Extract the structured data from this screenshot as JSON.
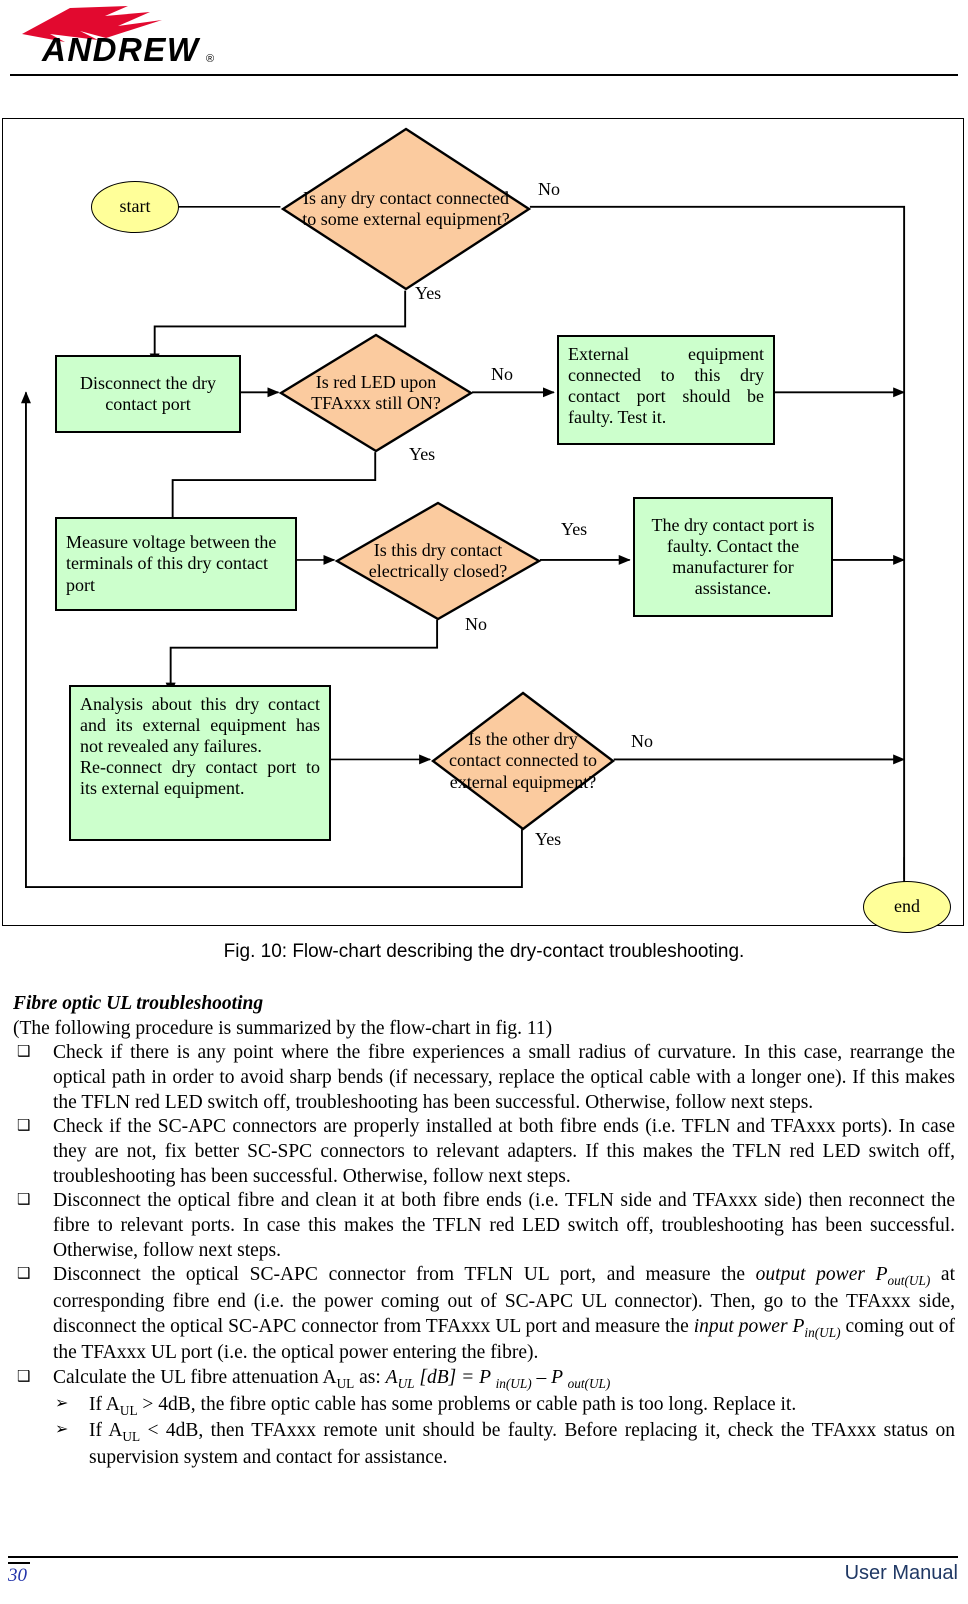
{
  "header": {
    "brand": "ANDREW",
    "registered_mark": "®"
  },
  "figure": {
    "caption": "Fig. 10: Flow-chart describing the dry-contact troubleshooting.",
    "colors": {
      "decision_fill": "#fbcb9f",
      "process_fill": "#ccffcc",
      "terminator_fill": "#ffff99",
      "stroke": "#000000"
    },
    "nodes": {
      "start": "start",
      "end": "end",
      "d1": "Is any dry contact connected to some external equipment?",
      "d2": "Is red LED upon TFAxxx still ON?",
      "d3": "Is this dry contact electrically closed?",
      "d4": "Is the other dry contact connected to external equipment?",
      "p1": "Disconnect the dry contact port",
      "p2": "External equipment connected to this dry contact port should be faulty. Test it.",
      "p3": "Measure voltage between the terminals of this dry contact port",
      "p4": "The dry contact port is faulty. Contact the manufacturer for assistance.",
      "p5_line1": "Analysis about this dry contact and its external equipment has not revealed any failures.",
      "p5_line2": "Re-connect dry contact port to its external equipment."
    },
    "edge_labels": {
      "d1_no": "No",
      "d1_yes": "Yes",
      "d2_no": "No",
      "d2_yes": "Yes",
      "d3_yes": "Yes",
      "d3_no": "No",
      "d4_no": "No",
      "d4_yes": "Yes"
    }
  },
  "section": {
    "heading": "Fibre optic UL troubleshooting",
    "intro": "(The following procedure is summarized by the flow-chart in fig. 11)",
    "bullet_glyph": "❑",
    "sub_glyph": "➢",
    "bullets": [
      "Check if there is any point where the fibre experiences a small radius of curvature. In this case, rearrange the optical path in order to avoid sharp bends (if necessary, replace the optical cable with a longer one). If this makes the TFLN red LED switch off, troubleshooting has been successful. Otherwise, follow next steps.",
      "Check if the SC-APC connectors are properly installed at both fibre ends (i.e. TFLN and TFAxxx ports). In case they are not, fix better SC-SPC connectors to relevant adapters. If this makes the TFLN red LED switch off, troubleshooting has been successful. Otherwise, follow next steps.",
      "Disconnect the optical fibre and clean it at both fibre ends (i.e. TFLN side and TFAxxx side) then reconnect the fibre to relevant ports. In case this makes the TFLN red LED switch off, troubleshooting has been successful. Otherwise, follow next steps."
    ],
    "bullet4": {
      "part1": "Disconnect the optical SC-APC connector from TFLN UL port, and measure the ",
      "italic1": "output power",
      "part2": " P",
      "sub1": "out(UL)",
      "part3": " at corresponding fibre end (i.e. the power coming out of SC-APC UL connector). Then, go to the TFAxxx side, disconnect the optical SC-APC connector from TFAxxx UL port and measure the ",
      "italic2": "input power P",
      "sub2": "in(UL)",
      "part4": " coming out of the TFAxxx UL port (i.e. the optical power entering the fibre)."
    },
    "bullet5": {
      "part1": "Calculate the UL fibre attenuation A",
      "sub1": "UL",
      "part2": " as: ",
      "formula_a": "A",
      "formula_a_sub": "UL",
      "formula_b": " [dB]  = P ",
      "formula_b_sub": "in(UL)",
      "formula_c": " – P ",
      "formula_c_sub": "out(UL)"
    },
    "subitems": [
      {
        "part1": "If A",
        "sub1": "UL",
        "part2": " > 4dB, the fibre optic cable has some problems or cable path is too long. Replace it."
      },
      {
        "part1": "If A",
        "sub1": "UL",
        "part2": " < 4dB, then TFAxxx remote unit should be faulty. Before replacing it, check the TFAxxx status on supervision system and contact for assistance."
      }
    ]
  },
  "footer": {
    "page_number": "30",
    "title": "User Manual"
  }
}
